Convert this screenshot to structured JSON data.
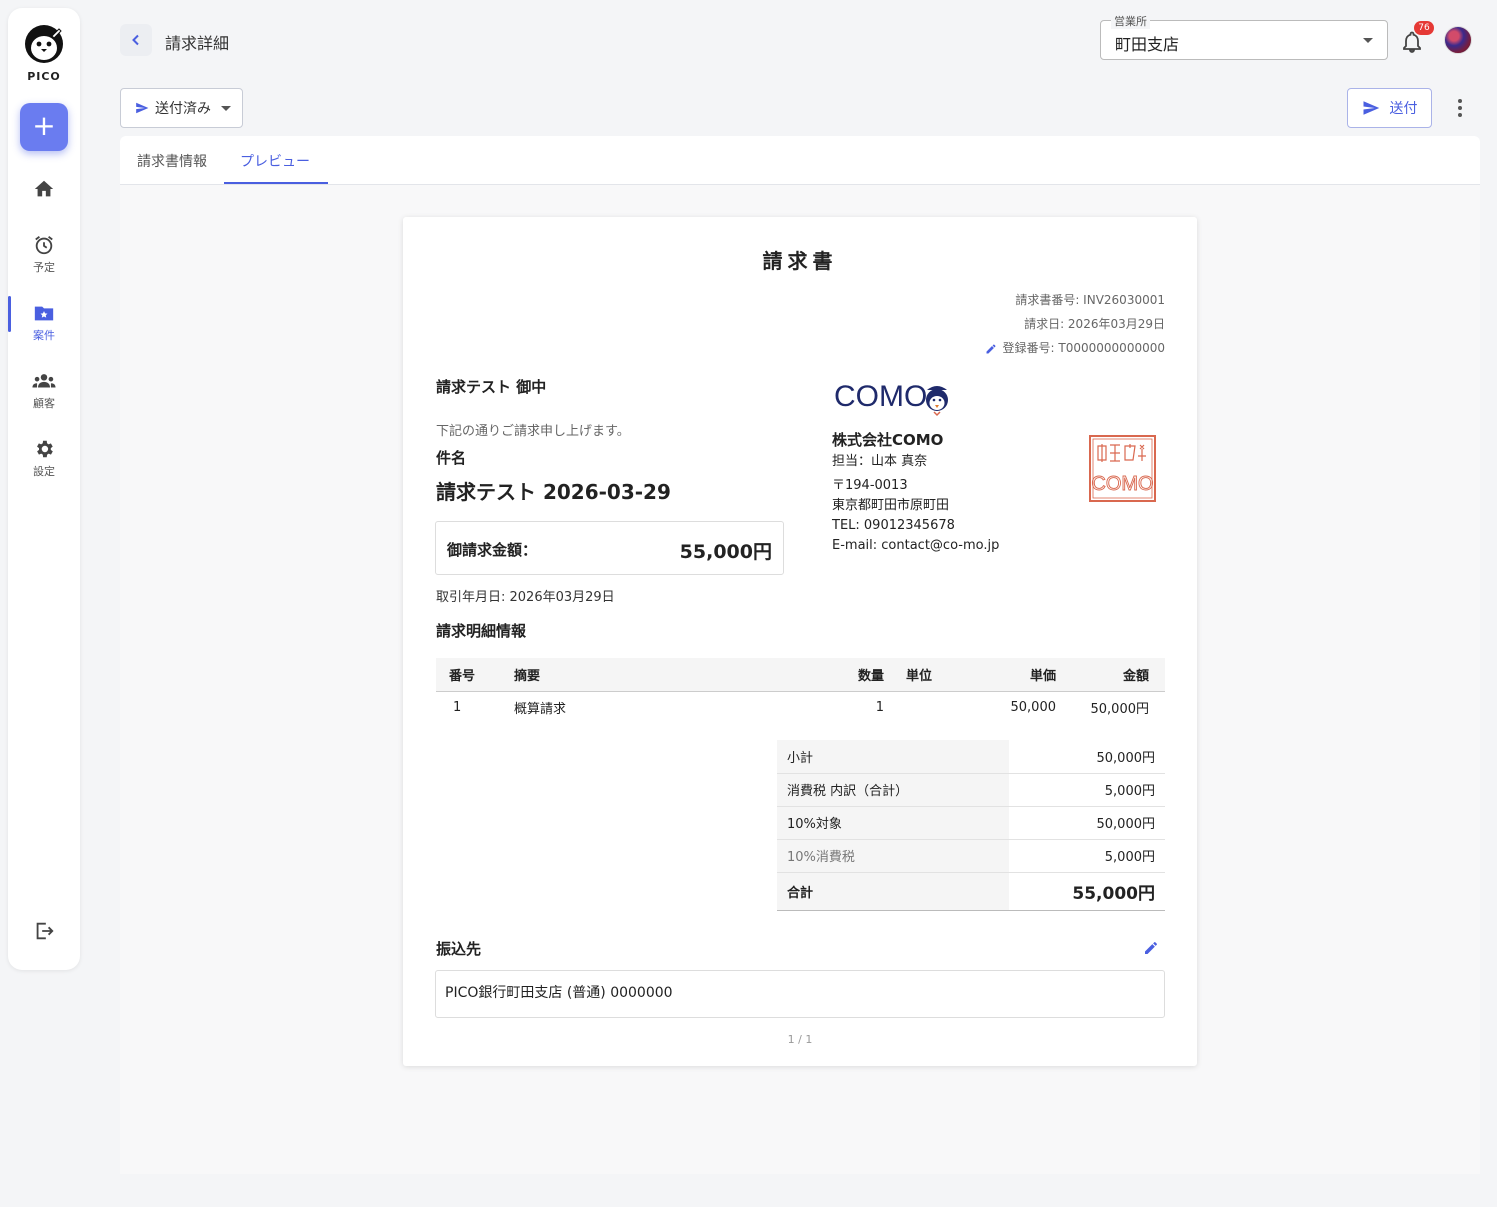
{
  "app": {
    "logo_text": "PICO"
  },
  "sidebar": {
    "add_label": "+",
    "items": [
      {
        "label": "",
        "icon": "home-icon"
      },
      {
        "label": "予定",
        "icon": "alarm-clock-icon"
      },
      {
        "label": "案件",
        "icon": "folder-star-icon",
        "active": true
      },
      {
        "label": "顧客",
        "icon": "people-icon"
      },
      {
        "label": "設定",
        "icon": "gear-icon"
      }
    ],
    "logout_icon": "logout-icon"
  },
  "header": {
    "title": "請求詳細",
    "office_label": "営業所",
    "office_value": "町田支店",
    "notification_count": "76"
  },
  "toolbar": {
    "status_label": "送付済み",
    "send_label": "送付"
  },
  "tabs": [
    {
      "label": "請求書情報"
    },
    {
      "label": "プレビュー",
      "active": true
    }
  ],
  "invoice": {
    "title": "請求書",
    "number": "請求書番号: INV26030001",
    "date": "請求日: 2026年03月29日",
    "registration": "登録番号: T0000000000000",
    "client": "請求テスト 御中",
    "greeting": "下記の通りご請求申し上げます。",
    "subject_label": "件名",
    "subject": "請求テスト 2026-03-29",
    "amount_label": "御請求金額：",
    "amount": "55,000円",
    "transaction_date": "取引年月日: 2026年03月29日",
    "detail_heading": "請求明細情報",
    "company": {
      "logo_text": "COMO",
      "name": "株式会社COMO",
      "contact": "担当：山本 真奈",
      "postal": "〒194-0013",
      "address": "東京都町田市原町田",
      "tel": "TEL: 09012345678",
      "email": "E-mail: contact@co-mo.jp",
      "seal_text": "COMO"
    },
    "table_headers": [
      "番号",
      "摘要",
      "数量",
      "単位",
      "単価",
      "金額"
    ],
    "rows": [
      [
        "1",
        "概算請求",
        "1",
        "",
        "50,000",
        "50,000円"
      ]
    ],
    "totals": [
      {
        "label": "小計",
        "value": "50,000円"
      },
      {
        "label": "消費税 内訳（合計）",
        "value": "5,000円"
      },
      {
        "label": "10%対象",
        "value": "50,000円"
      },
      {
        "label": "10%消費税",
        "value": "5,000円"
      },
      {
        "label": "合計",
        "value": "55,000円"
      }
    ],
    "bank_heading": "振込先",
    "bank": "PICO銀行町田支店 (普通) 0000000",
    "page": "1 / 1"
  },
  "colors": {
    "accent": "#4a5fe0",
    "seal": "#d9684f",
    "logo_navy": "#1f2a6b"
  }
}
